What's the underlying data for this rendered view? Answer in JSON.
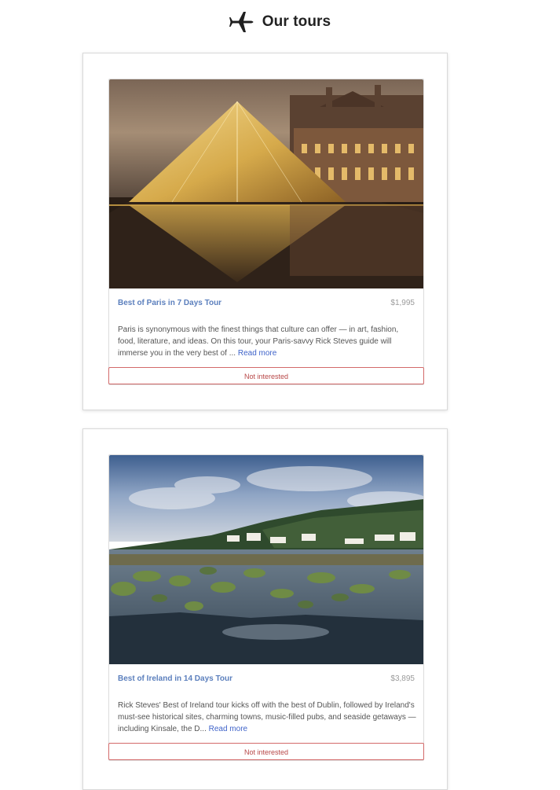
{
  "header": {
    "icon": "airplane-icon",
    "title": "Our tours"
  },
  "tours": [
    {
      "title": "Best of Paris in 7 Days Tour",
      "price": "$1,995",
      "description": "Paris is synonymous with the finest things that culture can offer — in art, fashion, food, literature, and ideas. On this tour, your Paris-savvy Rick Steves guide will immerse you in the very best of ... ",
      "read_more": "Read more",
      "button": "Not interested",
      "image_alt": "Louvre pyramid at night"
    },
    {
      "title": "Best of Ireland in 14 Days Tour",
      "price": "$3,895",
      "description": "Rick Steves' Best of Ireland tour kicks off with the best of Dublin, followed by Ireland's must-see historical sites, charming towns, music-filled pubs, and seaside getaways — including Kinsale, the D... ",
      "read_more": "Read more",
      "button": "Not interested",
      "image_alt": "Irish coastline at dusk"
    }
  ],
  "colors": {
    "title_link": "#5b7fbd",
    "read_more": "#3f63c9",
    "button_border": "#d36a6a",
    "button_text": "#b84747"
  }
}
